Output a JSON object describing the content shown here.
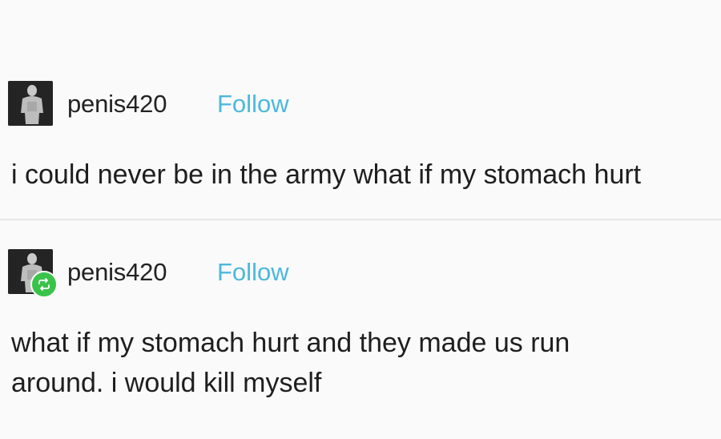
{
  "posts": [
    {
      "username": "penis420",
      "follow_label": "Follow",
      "text": "i could never be in the army what if my stomach hurt"
    },
    {
      "username": "penis420",
      "follow_label": "Follow",
      "text_lines": [
        "what if my stomach hurt and they made us run",
        "around. i would kill myself"
      ]
    }
  ],
  "icons": {
    "avatar": "avatar-silhouette-icon",
    "reblog": "reblog-icon"
  },
  "colors": {
    "follow": "#4cb8dd",
    "reblog_badge": "#3ac34a",
    "background": "#fafafa"
  }
}
